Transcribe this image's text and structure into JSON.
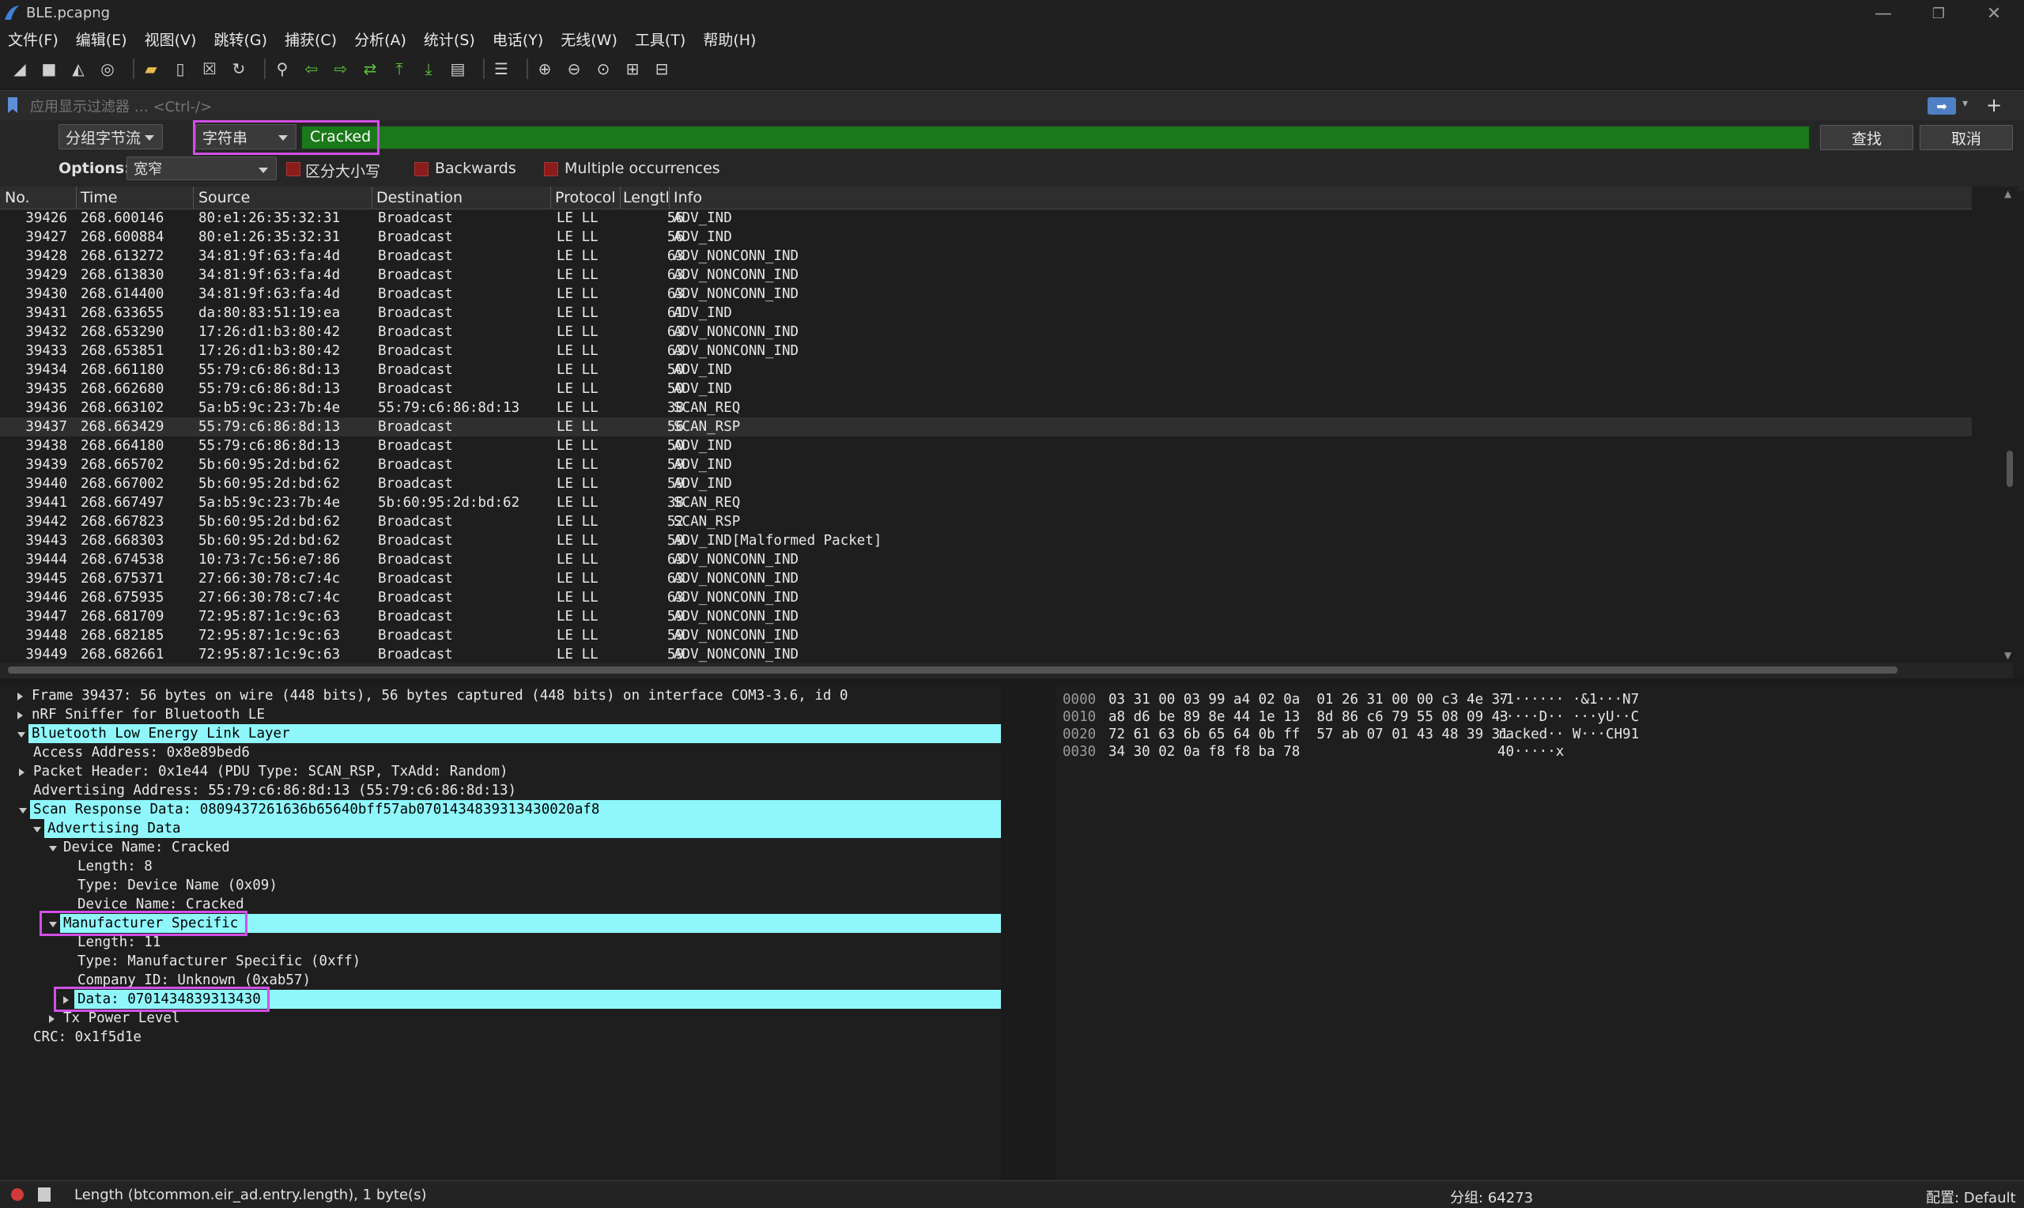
{
  "window": {
    "title": "BLE.pcapng",
    "min": "—",
    "restore": "❐",
    "close": "✕"
  },
  "menu": [
    "文件(F)",
    "编辑(E)",
    "视图(V)",
    "跳转(G)",
    "捕获(C)",
    "分析(A)",
    "统计(S)",
    "电话(Y)",
    "无线(W)",
    "工具(T)",
    "帮助(H)"
  ],
  "toolbar_icons": [
    "shark-fin-icon",
    "stop-square-icon",
    "restart-fin-icon",
    "options-gear-icon",
    "open-folder-icon",
    "file-icon",
    "close-file-icon",
    "reload-icon",
    "find-icon",
    "back-arrow-icon",
    "forward-arrow-icon",
    "goto-icon",
    "first-packet-icon",
    "last-packet-icon",
    "autoscroll-icon",
    "colorize-icon",
    "zoom-in-icon",
    "zoom-out-icon",
    "zoom-normal-icon",
    "resize-columns-icon",
    "layout-icon"
  ],
  "filter": {
    "placeholder": "应用显示过滤器 … <Ctrl-/>"
  },
  "find": {
    "scope": "分组字节流",
    "type": "字符串",
    "query": "Cracked",
    "find_label": "查找",
    "cancel_label": "取消",
    "options_label": "Options:",
    "charset": "宽窄",
    "case_label": "区分大小写",
    "backwards_label": "Backwards",
    "multiple_label": "Multiple occurrences"
  },
  "columns": [
    "No.",
    "Time",
    "Source",
    "Destination",
    "Protocol",
    "Lengtl",
    "Info"
  ],
  "packets": [
    {
      "no": "39426",
      "time": "268.600146",
      "src": "80:e1:26:35:32:31",
      "dst": "Broadcast",
      "proto": "LE LL",
      "len": "56",
      "info": "ADV_IND"
    },
    {
      "no": "39427",
      "time": "268.600884",
      "src": "80:e1:26:35:32:31",
      "dst": "Broadcast",
      "proto": "LE LL",
      "len": "56",
      "info": "ADV_IND"
    },
    {
      "no": "39428",
      "time": "268.613272",
      "src": "34:81:9f:63:fa:4d",
      "dst": "Broadcast",
      "proto": "LE LL",
      "len": "63",
      "info": "ADV_NONCONN_IND"
    },
    {
      "no": "39429",
      "time": "268.613830",
      "src": "34:81:9f:63:fa:4d",
      "dst": "Broadcast",
      "proto": "LE LL",
      "len": "63",
      "info": "ADV_NONCONN_IND"
    },
    {
      "no": "39430",
      "time": "268.614400",
      "src": "34:81:9f:63:fa:4d",
      "dst": "Broadcast",
      "proto": "LE LL",
      "len": "63",
      "info": "ADV_NONCONN_IND"
    },
    {
      "no": "39431",
      "time": "268.633655",
      "src": "da:80:83:51:19:ea",
      "dst": "Broadcast",
      "proto": "LE LL",
      "len": "61",
      "info": "ADV_IND"
    },
    {
      "no": "39432",
      "time": "268.653290",
      "src": "17:26:d1:b3:80:42",
      "dst": "Broadcast",
      "proto": "LE LL",
      "len": "63",
      "info": "ADV_NONCONN_IND"
    },
    {
      "no": "39433",
      "time": "268.653851",
      "src": "17:26:d1:b3:80:42",
      "dst": "Broadcast",
      "proto": "LE LL",
      "len": "63",
      "info": "ADV_NONCONN_IND"
    },
    {
      "no": "39434",
      "time": "268.661180",
      "src": "55:79:c6:86:8d:13",
      "dst": "Broadcast",
      "proto": "LE LL",
      "len": "50",
      "info": "ADV_IND"
    },
    {
      "no": "39435",
      "time": "268.662680",
      "src": "55:79:c6:86:8d:13",
      "dst": "Broadcast",
      "proto": "LE LL",
      "len": "50",
      "info": "ADV_IND"
    },
    {
      "no": "39436",
      "time": "268.663102",
      "src": "5a:b5:9c:23:7b:4e",
      "dst": "55:79:c6:86:8d:13",
      "proto": "LE LL",
      "len": "38",
      "info": "SCAN_REQ"
    },
    {
      "no": "39437",
      "time": "268.663429",
      "src": "55:79:c6:86:8d:13",
      "dst": "Broadcast",
      "proto": "LE LL",
      "len": "56",
      "info": "SCAN_RSP",
      "selected": true
    },
    {
      "no": "39438",
      "time": "268.664180",
      "src": "55:79:c6:86:8d:13",
      "dst": "Broadcast",
      "proto": "LE LL",
      "len": "50",
      "info": "ADV_IND"
    },
    {
      "no": "39439",
      "time": "268.665702",
      "src": "5b:60:95:2d:bd:62",
      "dst": "Broadcast",
      "proto": "LE LL",
      "len": "59",
      "info": "ADV_IND"
    },
    {
      "no": "39440",
      "time": "268.667002",
      "src": "5b:60:95:2d:bd:62",
      "dst": "Broadcast",
      "proto": "LE LL",
      "len": "59",
      "info": "ADV_IND"
    },
    {
      "no": "39441",
      "time": "268.667497",
      "src": "5a:b5:9c:23:7b:4e",
      "dst": "5b:60:95:2d:bd:62",
      "proto": "LE LL",
      "len": "38",
      "info": "SCAN_REQ"
    },
    {
      "no": "39442",
      "time": "268.667823",
      "src": "5b:60:95:2d:bd:62",
      "dst": "Broadcast",
      "proto": "LE LL",
      "len": "52",
      "info": "SCAN_RSP"
    },
    {
      "no": "39443",
      "time": "268.668303",
      "src": "5b:60:95:2d:bd:62",
      "dst": "Broadcast",
      "proto": "LE LL",
      "len": "59",
      "info": "ADV_IND[Malformed Packet]"
    },
    {
      "no": "39444",
      "time": "268.674538",
      "src": "10:73:7c:56:e7:86",
      "dst": "Broadcast",
      "proto": "LE LL",
      "len": "63",
      "info": "ADV_NONCONN_IND"
    },
    {
      "no": "39445",
      "time": "268.675371",
      "src": "27:66:30:78:c7:4c",
      "dst": "Broadcast",
      "proto": "LE LL",
      "len": "63",
      "info": "ADV_NONCONN_IND"
    },
    {
      "no": "39446",
      "time": "268.675935",
      "src": "27:66:30:78:c7:4c",
      "dst": "Broadcast",
      "proto": "LE LL",
      "len": "63",
      "info": "ADV_NONCONN_IND"
    },
    {
      "no": "39447",
      "time": "268.681709",
      "src": "72:95:87:1c:9c:63",
      "dst": "Broadcast",
      "proto": "LE LL",
      "len": "59",
      "info": "ADV_NONCONN_IND"
    },
    {
      "no": "39448",
      "time": "268.682185",
      "src": "72:95:87:1c:9c:63",
      "dst": "Broadcast",
      "proto": "LE LL",
      "len": "59",
      "info": "ADV_NONCONN_IND"
    },
    {
      "no": "39449",
      "time": "268.682661",
      "src": "72:95:87:1c:9c:63",
      "dst": "Broadcast",
      "proto": "LE LL",
      "len": "59",
      "info": "ADV_NONCONN_IND"
    }
  ],
  "details": [
    {
      "text": "Frame 39437: 56 bytes on wire (448 bits), 56 bytes captured (448 bits) on interface COM3-3.6, id 0",
      "level": 0,
      "tri": "right"
    },
    {
      "text": "nRF Sniffer for Bluetooth LE",
      "level": 0,
      "tri": "right"
    },
    {
      "text": "Bluetooth Low Energy Link Layer",
      "level": 0,
      "tri": "down",
      "hl": true
    },
    {
      "text": "Access Address: 0x8e89bed6",
      "level": 1,
      "tri": "none"
    },
    {
      "text": "Packet Header: 0x1e44 (PDU Type: SCAN_RSP, TxAdd: Random)",
      "level": 1,
      "tri": "right"
    },
    {
      "text": "Advertising Address: 55:79:c6:86:8d:13 (55:79:c6:86:8d:13)",
      "level": 1,
      "tri": "none"
    },
    {
      "text": "Scan Response Data: 0809437261636b65640bff57ab0701434839313430020af8",
      "level": 1,
      "tri": "down",
      "hl": true
    },
    {
      "text": "Advertising Data",
      "level": 2,
      "tri": "down",
      "hl": true
    },
    {
      "text": "Device Name: Cracked",
      "level": 3,
      "tri": "down"
    },
    {
      "text": "Length: 8",
      "level": 4,
      "tri": "none"
    },
    {
      "text": "Type: Device Name (0x09)",
      "level": 4,
      "tri": "none"
    },
    {
      "text": "Device Name: Cracked",
      "level": 4,
      "tri": "none"
    },
    {
      "text": "Manufacturer Specific",
      "level": 3,
      "tri": "down",
      "hl": true,
      "boxed": true
    },
    {
      "text": "Length: 11",
      "level": 4,
      "tri": "none"
    },
    {
      "text": "Type: Manufacturer Specific (0xff)",
      "level": 4,
      "tri": "none"
    },
    {
      "text": "Company ID: Unknown (0xab57)",
      "level": 4,
      "tri": "none"
    },
    {
      "text": "Data: 0701434839313430",
      "level": 4,
      "tri": "right",
      "hl": true,
      "boxed": true
    },
    {
      "text": "Tx Power Level",
      "level": 3,
      "tri": "right"
    },
    {
      "text": "CRC: 0x1f5d1e",
      "level": 1,
      "tri": "none"
    }
  ],
  "bytes": [
    {
      "offset": "0000",
      "hex": "03 31 00 03 99 a4 02 0a  01 26 31 00 00 c3 4e 37",
      "ascii": "·1······ ·&1···N7"
    },
    {
      "offset": "0010",
      "hex": "a8 d6 be 89 8e 44 1e 13  8d 86 c6 79 55 08 09 43",
      "ascii": "·····D·· ···yU··C"
    },
    {
      "offset": "0020",
      "hex": "72 61 63 6b 65 64 0b ff  57 ab 07 01 43 48 39 31",
      "ascii": "racked·· W···CH91"
    },
    {
      "offset": "0030",
      "hex": "34 30 02 0a f8 f8 ba 78",
      "ascii": "40·····x"
    }
  ],
  "status": {
    "field_info": "Length (btcommon.eir_ad.entry.length), 1 byte(s)",
    "packets": "分组: 64273",
    "profile": "配置: Default"
  },
  "colors": {
    "highlight": "#8ff7fb",
    "find_box": "#d14fe6",
    "search_bg": "#1a7a1a"
  }
}
